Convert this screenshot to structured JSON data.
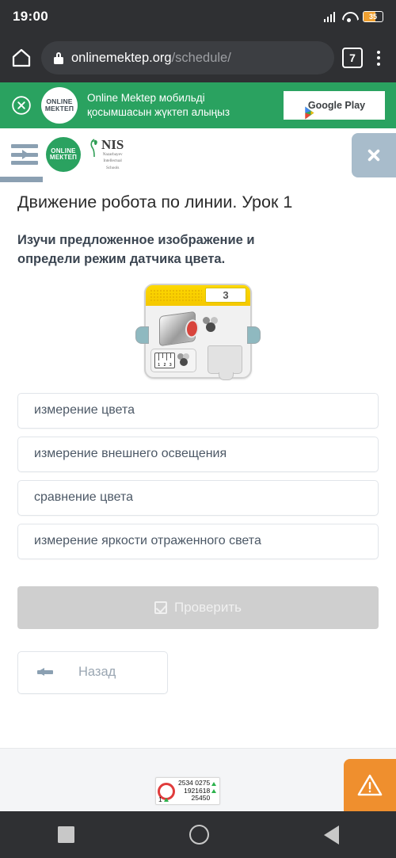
{
  "status_bar": {
    "time": "19:00",
    "battery_percent": "35",
    "signal_icon": "signal-bars-icon",
    "wifi_icon": "wifi-icon",
    "battery_icon": "battery-icon"
  },
  "browser": {
    "home_icon": "home-icon",
    "lock_icon": "lock-icon",
    "url_domain": "onlinemektep.org",
    "url_path": "/schedule/",
    "tab_count": "7",
    "menu_icon": "kebab-menu-icon"
  },
  "app_banner": {
    "close_icon": "close-circle-icon",
    "logo_line1": "ONLINE",
    "logo_line2": "МЕКТЕП",
    "text_line1": "Online Mektep мобильді",
    "text_line2": "қосымшасын жүктеп алыңыз",
    "store_button_label": "Google Play",
    "store_icon": "google-play-icon",
    "background_color": "#2aa260"
  },
  "site_header": {
    "menu_icon": "menu-indent-icon",
    "brand_logo_line1": "ONLINE",
    "brand_logo_line2": "МЕКТЕП",
    "nis_logo_main": "NIS",
    "nis_logo_sub_line1": "Nazarbayev",
    "nis_logo_sub_line2": "Intellectual",
    "nis_logo_sub_line3": "Schools",
    "list_icon": "list-view-icon",
    "close_icon": "close-x-icon"
  },
  "lesson": {
    "title": "Движение робота по линии. Урок 1",
    "question_line1": "Изучи предложенное изображение и",
    "question_line2": "определи режим датчика цвета."
  },
  "sensor_block": {
    "icon_name": "ev3-color-sensor-block",
    "port_number": "3",
    "header_color": "#fdd800",
    "lens_color": "#d8443c"
  },
  "options": [
    {
      "label": "измерение цвета"
    },
    {
      "label": "измерение внешнего освещения"
    },
    {
      "label": "сравнение цвета"
    },
    {
      "label": "измерение яркости отраженного света"
    }
  ],
  "actions": {
    "check_label": "Проверить",
    "check_icon": "checkbox-checked-icon",
    "check_disabled_color": "#cfcfcf",
    "back_label": "Назад",
    "back_icon": "arrow-left-icon"
  },
  "footer": {
    "counter_icon": "red-ring-icon",
    "counter_line1": "2534 0275",
    "counter_line2": "1921618",
    "counter_line3": "25450",
    "counter_bottom_left": "1",
    "up_arrow_icon": "triangle-up-icon",
    "warning_icon": "warning-triangle-icon",
    "warning_color": "#ef8f2e"
  },
  "android_nav": {
    "recents_icon": "square-recents-icon",
    "home_icon": "circle-home-icon",
    "back_icon": "triangle-back-icon"
  }
}
